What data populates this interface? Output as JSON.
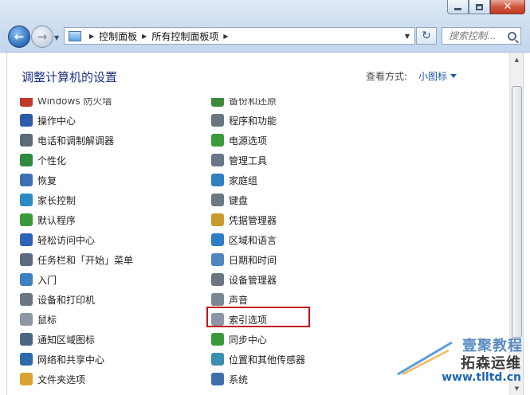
{
  "window": {
    "breadcrumbs": [
      "控制面板",
      "所有控制面板项"
    ],
    "search_placeholder": "搜索控制...",
    "page_title": "调整计算机的设置",
    "view_by_label": "查看方式:",
    "view_by_value": "小图标"
  },
  "items_left": [
    {
      "label": "Windows 防火墙",
      "icon": "firewall-icon",
      "color": "#c0392b"
    },
    {
      "label": "操作中心",
      "icon": "flag-icon",
      "color": "#2a5caa"
    },
    {
      "label": "电话和调制解调器",
      "icon": "phone-modem-icon",
      "color": "#5d6a7a"
    },
    {
      "label": "个性化",
      "icon": "personalization-icon",
      "color": "#2f8a3e"
    },
    {
      "label": "恢复",
      "icon": "recovery-icon",
      "color": "#3f6fb2"
    },
    {
      "label": "家长控制",
      "icon": "parental-icon",
      "color": "#2b8cc4"
    },
    {
      "label": "默认程序",
      "icon": "default-programs-icon",
      "color": "#3a9a3a"
    },
    {
      "label": "轻松访问中心",
      "icon": "ease-access-icon",
      "color": "#2c63b8"
    },
    {
      "label": "任务栏和「开始」菜单",
      "icon": "taskbar-icon",
      "color": "#5b6b80"
    },
    {
      "label": "入门",
      "icon": "getting-started-icon",
      "color": "#3d7fc0"
    },
    {
      "label": "设备和打印机",
      "icon": "printer-icon",
      "color": "#6b7684"
    },
    {
      "label": "鼠标",
      "icon": "mouse-icon",
      "color": "#8d96a2"
    },
    {
      "label": "通知区域图标",
      "icon": "notification-icon",
      "color": "#4b6582"
    },
    {
      "label": "网络和共享中心",
      "icon": "network-icon",
      "color": "#2d6aa8"
    },
    {
      "label": "文件夹选项",
      "icon": "folder-icon",
      "color": "#d9a531"
    }
  ],
  "items_right": [
    {
      "label": "备份和还原",
      "icon": "backup-icon",
      "color": "#3d8a3d"
    },
    {
      "label": "程序和功能",
      "icon": "programs-icon",
      "color": "#6b7682"
    },
    {
      "label": "电源选项",
      "icon": "power-icon",
      "color": "#3b9a3b"
    },
    {
      "label": "管理工具",
      "icon": "admin-tools-icon",
      "color": "#6a7686"
    },
    {
      "label": "家庭组",
      "icon": "homegroup-icon",
      "color": "#2f7fc2"
    },
    {
      "label": "键盘",
      "icon": "keyboard-icon",
      "color": "#6e7884"
    },
    {
      "label": "凭据管理器",
      "icon": "credential-icon",
      "color": "#c89a2a"
    },
    {
      "label": "区域和语言",
      "icon": "region-icon",
      "color": "#2d7dc4"
    },
    {
      "label": "日期和时间",
      "icon": "clock-icon",
      "color": "#4f86c0"
    },
    {
      "label": "设备管理器",
      "icon": "device-manager-icon",
      "color": "#6b7480"
    },
    {
      "label": "声音",
      "icon": "speaker-icon",
      "color": "#7b8794"
    },
    {
      "label": "索引选项",
      "icon": "indexing-icon",
      "color": "#8a96a6"
    },
    {
      "label": "同步中心",
      "icon": "sync-icon",
      "color": "#3a9a3a"
    },
    {
      "label": "位置和其他传感器",
      "icon": "sensor-icon",
      "color": "#3a8fb0"
    },
    {
      "label": "系统",
      "icon": "system-icon",
      "color": "#3f6fa8"
    }
  ],
  "watermark": {
    "line1": "壹聚教程",
    "line2": "拓森运维",
    "url": "www.tlltd.cn"
  }
}
